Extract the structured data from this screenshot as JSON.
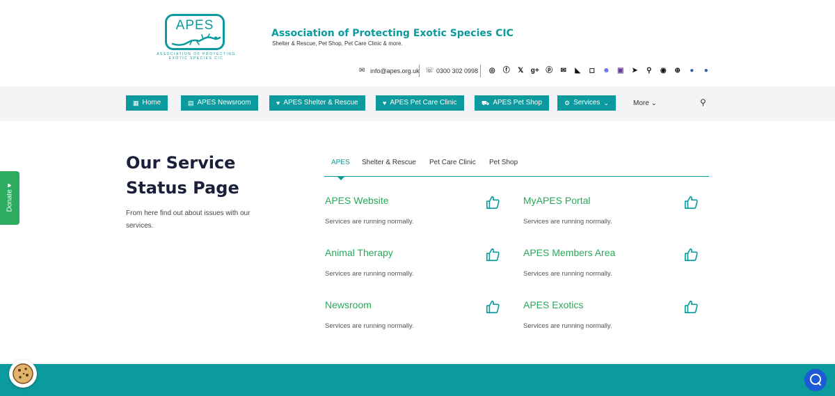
{
  "header": {
    "logo_text": "APES",
    "logo_sub_1": "ASSOCIATION OF PROTECTING",
    "logo_sub_2": "EXOTIC SPECIES CIC",
    "org_name": "Association of Protecting Exotic Species CIC",
    "tagline": "Shelter & Rescue, Pet Shop, Pet Care Clinic & more.",
    "email": "info@apes.org.uk",
    "phone": "0300 302 0998",
    "social_icons": [
      "whatsapp-icon",
      "facebook-icon",
      "x-icon",
      "google-plus-icon",
      "pinterest-icon",
      "email-icon",
      "rss-icon",
      "instagram-icon",
      "discord-icon",
      "twitch-icon",
      "telegram-icon",
      "location-icon",
      "messenger-icon",
      "globe-icon",
      "web-icon",
      "website-icon"
    ]
  },
  "nav": {
    "items": [
      {
        "label": "Home",
        "icon": "building-icon"
      },
      {
        "label": "APES Newsroom",
        "icon": "newspaper-icon"
      },
      {
        "label": "APES Shelter & Rescue",
        "icon": "heart-icon"
      },
      {
        "label": "APES Pet Care Clinic",
        "icon": "heart-icon"
      },
      {
        "label": "APES Pet Shop",
        "icon": "cart-icon"
      },
      {
        "label": "Services",
        "icon": "gear-icon"
      }
    ],
    "more_label": "More"
  },
  "main": {
    "title_line1": "Our Service",
    "title_line2": "Status Page",
    "description": "From here find out about issues with our services.",
    "tabs": [
      "APES",
      "Shelter & Rescue",
      "Pet Care Clinic",
      "Pet Shop"
    ],
    "active_tab": "APES",
    "services": [
      {
        "name": "APES Website",
        "status": "Services are running normally."
      },
      {
        "name": "MyAPES Portal",
        "status": "Services are running normally."
      },
      {
        "name": "Animal Therapy",
        "status": "Services are running normally."
      },
      {
        "name": "APES Members Area",
        "status": "Services are running normally."
      },
      {
        "name": "Newsroom",
        "status": "Services are running normally."
      },
      {
        "name": "APES Exotics",
        "status": "Services are running normally."
      }
    ]
  },
  "donate": {
    "label": "Donate"
  },
  "colors": {
    "brand": "#0b9a9d",
    "status_ok": "#2aa85a",
    "donate": "#2dab60",
    "chat": "#1d5bd6"
  }
}
